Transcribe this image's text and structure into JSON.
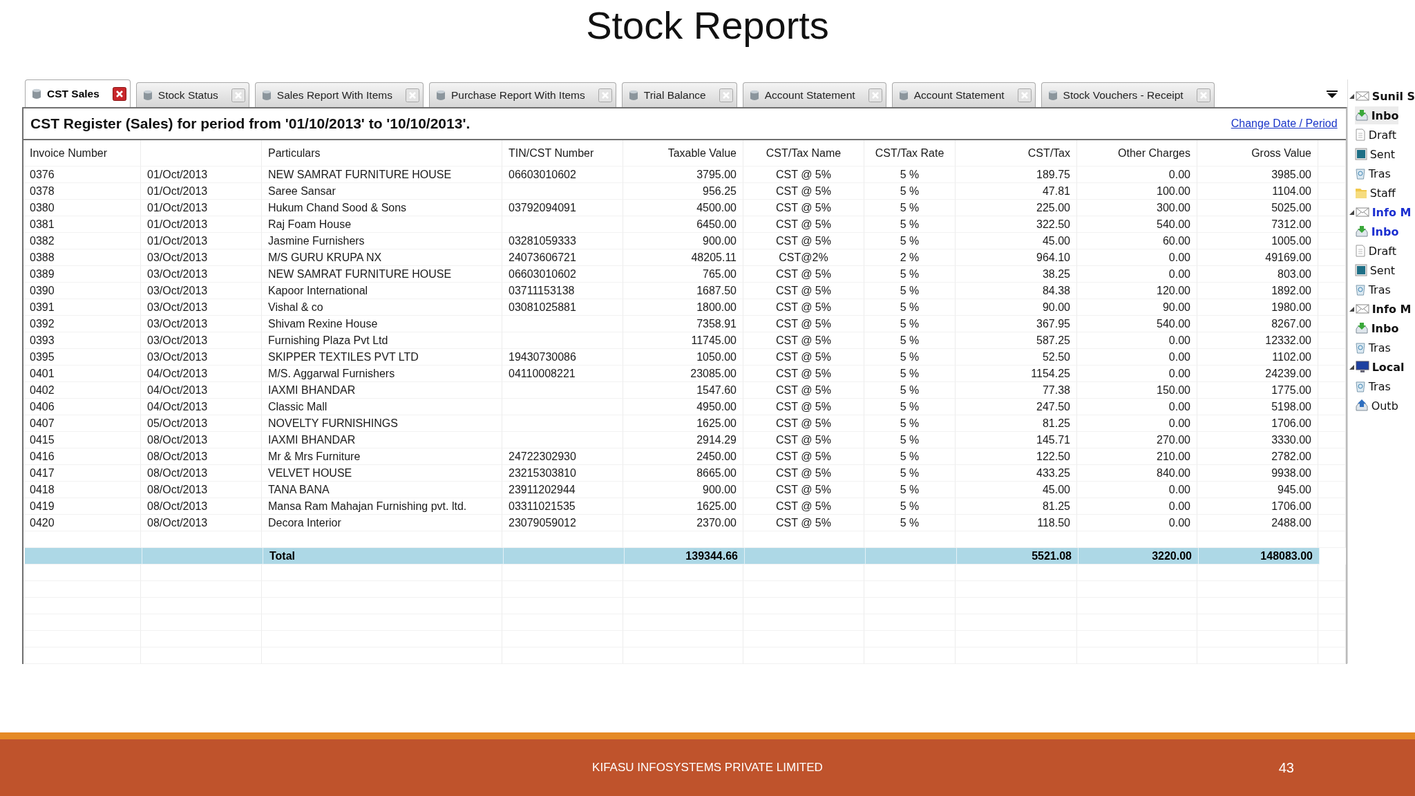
{
  "slide": {
    "title": "Stock Reports",
    "footer": "KIFASU INFOSYSTEMS PRIVATE LIMITED",
    "page_number": "43"
  },
  "tabs": [
    {
      "label": "CST Sales",
      "selected": true
    },
    {
      "label": "Stock Status",
      "selected": false
    },
    {
      "label": "Sales Report With Items",
      "selected": false
    },
    {
      "label": "Purchase Report With Items",
      "selected": false
    },
    {
      "label": "Trial Balance",
      "selected": false
    },
    {
      "label": "Account Statement",
      "selected": false
    },
    {
      "label": "Account Statement",
      "selected": false
    },
    {
      "label": "Stock Vouchers - Receipt",
      "selected": false
    }
  ],
  "report": {
    "heading": "CST Register (Sales) for period from '01/10/2013' to '10/10/2013'.",
    "change_link": "Change Date / Period"
  },
  "table": {
    "columns": [
      "Invoice Number",
      "Particulars",
      "TIN/CST Number",
      "Taxable Value",
      "CST/Tax Name",
      "CST/Tax Rate",
      "CST/Tax",
      "Other Charges",
      "Gross Value"
    ],
    "rows": [
      {
        "invoice": "0376",
        "date": "01/Oct/2013",
        "particulars": "NEW SAMRAT FURNITURE HOUSE",
        "tin": "06603010602",
        "taxable_value": "3795.00",
        "tax_name": "CST @ 5%",
        "tax_rate": "5 %",
        "cst_tax": "189.75",
        "other_charges": "0.00",
        "gross_value": "3985.00"
      },
      {
        "invoice": "0378",
        "date": "01/Oct/2013",
        "particulars": "Saree Sansar",
        "taxable_value": "956.25",
        "tax_name": "CST @ 5%",
        "tax_rate": "5 %",
        "cst_tax": "47.81",
        "other_charges": "100.00",
        "gross_value": "1104.00"
      },
      {
        "invoice": "0380",
        "date": "01/Oct/2013",
        "particulars": "Hukum Chand Sood & Sons",
        "tin": "03792094091",
        "taxable_value": "4500.00",
        "tax_name": "CST @ 5%",
        "tax_rate": "5 %",
        "cst_tax": "225.00",
        "other_charges": "300.00",
        "gross_value": "5025.00"
      },
      {
        "invoice": "0381",
        "date": "01/Oct/2013",
        "particulars": "Raj Foam House",
        "taxable_value": "6450.00",
        "tax_name": "CST @ 5%",
        "tax_rate": "5 %",
        "cst_tax": "322.50",
        "other_charges": "540.00",
        "gross_value": "7312.00"
      },
      {
        "invoice": "0382",
        "date": "01/Oct/2013",
        "particulars": "Jasmine Furnishers",
        "tin": "03281059333",
        "taxable_value": "900.00",
        "tax_name": "CST @ 5%",
        "tax_rate": "5 %",
        "cst_tax": "45.00",
        "other_charges": "60.00",
        "gross_value": "1005.00"
      },
      {
        "invoice": "0388",
        "date": "03/Oct/2013",
        "particulars": "M/S GURU KRUPA NX",
        "tin": "24073606721",
        "taxable_value": "48205.11",
        "tax_name": "CST@2%",
        "tax_rate": "2 %",
        "cst_tax": "964.10",
        "other_charges": "0.00",
        "gross_value": "49169.00"
      },
      {
        "invoice": "0389",
        "date": "03/Oct/2013",
        "particulars": "NEW SAMRAT FURNITURE HOUSE",
        "tin": "06603010602",
        "taxable_value": "765.00",
        "tax_name": "CST @ 5%",
        "tax_rate": "5 %",
        "cst_tax": "38.25",
        "other_charges": "0.00",
        "gross_value": "803.00"
      },
      {
        "invoice": "0390",
        "date": "03/Oct/2013",
        "particulars": "Kapoor International",
        "tin": "03711153138",
        "taxable_value": "1687.50",
        "tax_name": "CST @ 5%",
        "tax_rate": "5 %",
        "cst_tax": "84.38",
        "other_charges": "120.00",
        "gross_value": "1892.00"
      },
      {
        "invoice": "0391",
        "date": "03/Oct/2013",
        "particulars": "Vishal & co",
        "tin": "03081025881",
        "taxable_value": "1800.00",
        "tax_name": "CST @ 5%",
        "tax_rate": "5 %",
        "cst_tax": "90.00",
        "other_charges": "90.00",
        "gross_value": "1980.00"
      },
      {
        "invoice": "0392",
        "date": "03/Oct/2013",
        "particulars": "Shivam Rexine House",
        "taxable_value": "7358.91",
        "tax_name": "CST @ 5%",
        "tax_rate": "5 %",
        "cst_tax": "367.95",
        "other_charges": "540.00",
        "gross_value": "8267.00"
      },
      {
        "invoice": "0393",
        "date": "03/Oct/2013",
        "particulars": "Furnishing Plaza Pvt Ltd",
        "taxable_value": "11745.00",
        "tax_name": "CST @ 5%",
        "tax_rate": "5 %",
        "cst_tax": "587.25",
        "other_charges": "0.00",
        "gross_value": "12332.00"
      },
      {
        "invoice": "0395",
        "date": "03/Oct/2013",
        "particulars": "SKIPPER TEXTILES PVT LTD",
        "tin": "19430730086",
        "taxable_value": "1050.00",
        "tax_name": "CST @ 5%",
        "tax_rate": "5 %",
        "cst_tax": "52.50",
        "other_charges": "0.00",
        "gross_value": "1102.00"
      },
      {
        "invoice": "0401",
        "date": "04/Oct/2013",
        "particulars": "M/S. Aggarwal Furnishers",
        "tin": "04110008221",
        "taxable_value": "23085.00",
        "tax_name": "CST @ 5%",
        "tax_rate": "5 %",
        "cst_tax": "1154.25",
        "other_charges": "0.00",
        "gross_value": "24239.00"
      },
      {
        "invoice": "0402",
        "date": "04/Oct/2013",
        "particulars": "IAXMI BHANDAR",
        "taxable_value": "1547.60",
        "tax_name": "CST @ 5%",
        "tax_rate": "5 %",
        "cst_tax": "77.38",
        "other_charges": "150.00",
        "gross_value": "1775.00"
      },
      {
        "invoice": "0406",
        "date": "04/Oct/2013",
        "particulars": "Classic Mall",
        "taxable_value": "4950.00",
        "tax_name": "CST @ 5%",
        "tax_rate": "5 %",
        "cst_tax": "247.50",
        "other_charges": "0.00",
        "gross_value": "5198.00"
      },
      {
        "invoice": "0407",
        "date": "05/Oct/2013",
        "particulars": "NOVELTY FURNISHINGS",
        "taxable_value": "1625.00",
        "tax_name": "CST @ 5%",
        "tax_rate": "5 %",
        "cst_tax": "81.25",
        "other_charges": "0.00",
        "gross_value": "1706.00"
      },
      {
        "invoice": "0415",
        "date": "08/Oct/2013",
        "particulars": "IAXMI BHANDAR",
        "taxable_value": "2914.29",
        "tax_name": "CST @ 5%",
        "tax_rate": "5 %",
        "cst_tax": "145.71",
        "other_charges": "270.00",
        "gross_value": "3330.00"
      },
      {
        "invoice": "0416",
        "date": "08/Oct/2013",
        "particulars": "Mr & Mrs Furniture",
        "tin": "24722302930",
        "taxable_value": "2450.00",
        "tax_name": "CST @ 5%",
        "tax_rate": "5 %",
        "cst_tax": "122.50",
        "other_charges": "210.00",
        "gross_value": "2782.00"
      },
      {
        "invoice": "0417",
        "date": "08/Oct/2013",
        "particulars": "VELVET HOUSE",
        "tin": "23215303810",
        "taxable_value": "8665.00",
        "tax_name": "CST @ 5%",
        "tax_rate": "5 %",
        "cst_tax": "433.25",
        "other_charges": "840.00",
        "gross_value": "9938.00"
      },
      {
        "invoice": "0418",
        "date": "08/Oct/2013",
        "particulars": "TANA BANA",
        "tin": "23911202944",
        "taxable_value": "900.00",
        "tax_name": "CST @ 5%",
        "tax_rate": "5 %",
        "cst_tax": "45.00",
        "other_charges": "0.00",
        "gross_value": "945.00"
      },
      {
        "invoice": "0419",
        "date": "08/Oct/2013",
        "particulars": "Mansa Ram Mahajan Furnishing pvt. ltd.",
        "tin": "03311021535",
        "taxable_value": "1625.00",
        "tax_name": "CST @ 5%",
        "tax_rate": "5 %",
        "cst_tax": "81.25",
        "other_charges": "0.00",
        "gross_value": "1706.00"
      },
      {
        "invoice": "0420",
        "date": "08/Oct/2013",
        "particulars": "Decora Interior",
        "tin": "23079059012",
        "taxable_value": "2370.00",
        "tax_name": "CST @ 5%",
        "tax_rate": "5 %",
        "cst_tax": "118.50",
        "other_charges": "0.00",
        "gross_value": "2488.00"
      }
    ],
    "total": {
      "particulars": "Total",
      "taxable_value": "139344.66",
      "cst_tax": "5521.08",
      "other_charges": "3220.00",
      "gross_value": "148083.00"
    }
  },
  "folder_tree": [
    {
      "label": "Sunil S",
      "kind": "account",
      "unread": true,
      "new": false,
      "selected": false,
      "children": [
        {
          "label": "Inbo",
          "kind": "inbox",
          "unread": true,
          "new": false,
          "selected": true
        },
        {
          "label": "Draft",
          "kind": "drafts",
          "unread": false,
          "new": false,
          "selected": false
        },
        {
          "label": "Sent",
          "kind": "sent",
          "unread": false,
          "new": false,
          "selected": false
        },
        {
          "label": "Tras",
          "kind": "trash",
          "unread": false,
          "new": false,
          "selected": false
        },
        {
          "label": "Staff",
          "kind": "folder",
          "unread": false,
          "new": false,
          "selected": false
        }
      ]
    },
    {
      "label": "Info M",
      "kind": "account",
      "unread": true,
      "new": true,
      "selected": false,
      "children": [
        {
          "label": "Inbo",
          "kind": "inbox",
          "unread": true,
          "new": true,
          "selected": false
        },
        {
          "label": "Draft",
          "kind": "drafts",
          "unread": false,
          "new": false,
          "selected": false
        },
        {
          "label": "Sent",
          "kind": "sent",
          "unread": false,
          "new": false,
          "selected": false
        },
        {
          "label": "Tras",
          "kind": "trash",
          "unread": false,
          "new": false,
          "selected": false
        }
      ]
    },
    {
      "label": "Info M",
      "kind": "account",
      "unread": true,
      "new": false,
      "selected": false,
      "children": [
        {
          "label": "Inbo",
          "kind": "inbox",
          "unread": true,
          "new": false,
          "selected": false
        },
        {
          "label": "Tras",
          "kind": "trash",
          "unread": false,
          "new": false,
          "selected": false
        }
      ]
    },
    {
      "label": "Local",
      "kind": "local",
      "unread": true,
      "new": false,
      "selected": false,
      "children": [
        {
          "label": "Tras",
          "kind": "trash",
          "unread": false,
          "new": false,
          "selected": false
        },
        {
          "label": "Outb",
          "kind": "outbox",
          "unread": false,
          "new": false,
          "selected": false
        }
      ]
    }
  ]
}
